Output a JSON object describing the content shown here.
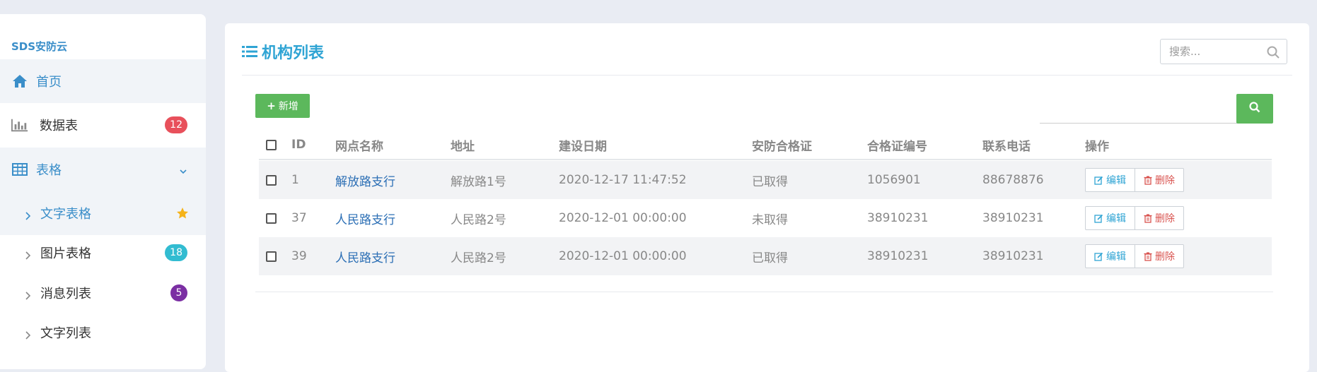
{
  "sidebar": {
    "brand": "SDS安防云",
    "items": [
      {
        "label": "首页",
        "icon": "home-icon"
      },
      {
        "label": "数据表",
        "icon": "bar-chart-icon",
        "badge": "12",
        "badge_color": "#e8505b"
      },
      {
        "label": "表格",
        "icon": "table-icon"
      },
      {
        "label": "文字表格",
        "icon": "chevron-right-icon",
        "starred": true
      },
      {
        "label": "图片表格",
        "icon": "chevron-right-icon",
        "badge": "18",
        "badge_color": "#32bcd1"
      },
      {
        "label": "消息列表",
        "icon": "chevron-right-icon",
        "badge": "5",
        "badge_color": "#7b2fa3"
      },
      {
        "label": "文字列表",
        "icon": "chevron-right-icon"
      }
    ]
  },
  "panel": {
    "title": "机构列表",
    "search_placeholder": "搜索...",
    "add_label": "新增"
  },
  "table": {
    "headers": [
      "ID",
      "网点名称",
      "地址",
      "建设日期",
      "安防合格证",
      "合格证编号",
      "联系电话",
      "操作"
    ],
    "rows": [
      {
        "id": "1",
        "name": "解放路支行",
        "address": "解放路1号",
        "date": "2020-12-17 11:47:52",
        "cert": "已取得",
        "cert_no": "1056901",
        "phone": "88678876"
      },
      {
        "id": "37",
        "name": "人民路支行",
        "address": "人民路2号",
        "date": "2020-12-01 00:00:00",
        "cert": "未取得",
        "cert_no": "38910231",
        "phone": "38910231"
      },
      {
        "id": "39",
        "name": "人民路支行",
        "address": "人民路2号",
        "date": "2020-12-01 00:00:00",
        "cert": "已取得",
        "cert_no": "38910231",
        "phone": "38910231"
      }
    ],
    "edit_label": "编辑",
    "delete_label": "删除"
  },
  "colors": {
    "accent": "#2fa4d4",
    "link": "#2c6fb5",
    "success": "#5cb85c",
    "danger": "#d9534f"
  }
}
